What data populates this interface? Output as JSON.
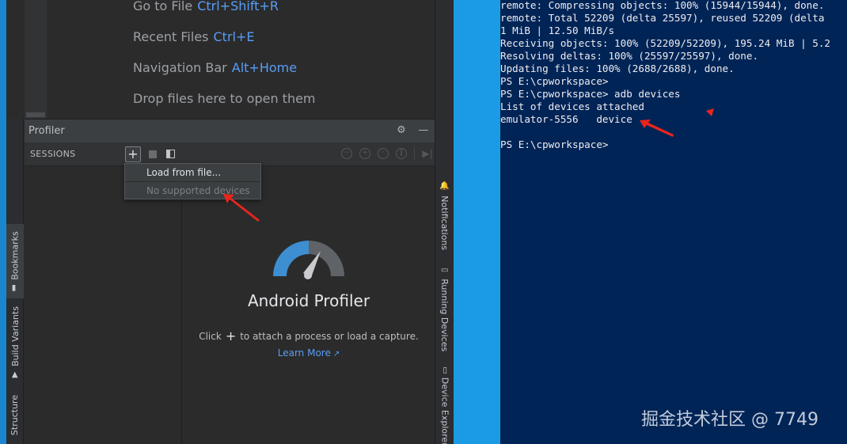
{
  "editor_hints": [
    {
      "label": "Go to File",
      "shortcut": "Ctrl+Shift+R"
    },
    {
      "label": "Recent Files",
      "shortcut": "Ctrl+E"
    },
    {
      "label": "Navigation Bar",
      "shortcut": "Alt+Home"
    },
    {
      "label": "Drop files here to open them",
      "shortcut": ""
    }
  ],
  "left_tool_tabs": {
    "bookmarks": "Bookmarks",
    "build_variants": "Build Variants",
    "structure": "Structure"
  },
  "right_tool_tabs": {
    "notifications": "Notifications",
    "running_devices": "Running Devices",
    "device_explorer": "Device Explorer"
  },
  "profiler": {
    "title": "Profiler",
    "sessions_label": "SESSIONS",
    "add_session_glyph": "+",
    "dropdown_items": [
      {
        "label": "Load from file...",
        "enabled": true
      },
      {
        "label": "No supported devices",
        "enabled": false
      }
    ],
    "product_name": "Android Profiler",
    "attach_before": "Click",
    "attach_glyph": "+",
    "attach_after": "to attach a process or load a capture.",
    "learn_more": "Learn More",
    "learn_more_glyph": "↗"
  },
  "terminal": {
    "lines": [
      "remote: Compressing objects: 100% (15944/15944), done.",
      "remote: Total 52209 (delta 25597), reused 52209 (delta",
      "1 MiB | 12.50 MiB/s",
      "Receiving objects: 100% (52209/52209), 195.24 MiB | 5.2",
      "Resolving deltas: 100% (25597/25597), done.",
      "Updating files: 100% (2688/2688), done.",
      "PS E:\\cpworkspace>",
      "PS E:\\cpworkspace> adb devices",
      "List of devices attached",
      "emulator-5556   device",
      "",
      "PS E:\\cpworkspace>"
    ]
  },
  "watermark": "掘金技术社区 @ 7749",
  "colors": {
    "ide_background": "#2b2b2b",
    "link_blue": "#589df6",
    "terminal_background": "#012456",
    "desktop_blue": "#1f8fd6",
    "annotation_red": "#e8251f",
    "gauge_blue": "#3d8fd1",
    "gauge_gray": "#5f6266"
  }
}
